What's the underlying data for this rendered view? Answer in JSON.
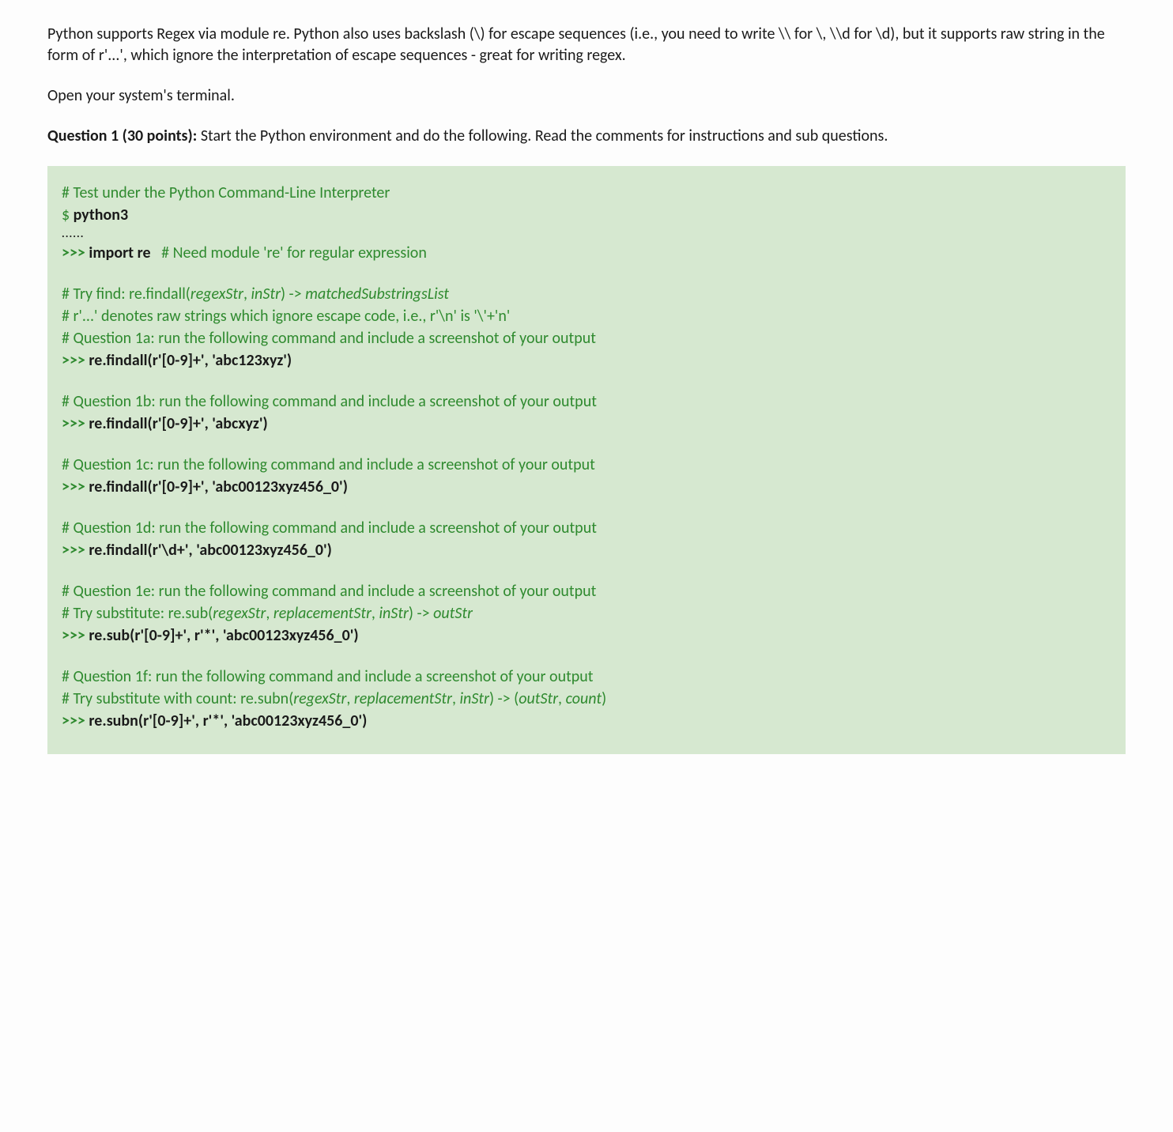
{
  "intro": {
    "p1": "Python supports Regex via module re. Python also uses backslash (\\) for escape sequences (i.e., you need to write \\\\ for \\, \\\\d for \\d), but it supports raw string in the form of r'...', which ignore the interpretation of escape sequences - great for writing regex.",
    "p2": "Open your system's terminal.",
    "q_lead_bold": "Question 1 (30 points): ",
    "q_lead_rest": "Start the Python environment and do the following. Read the comments for instructions and sub questions."
  },
  "code": {
    "c1": "# Test under the Python Command-Line Interpreter",
    "dollar": "$ ",
    "py3": "python3",
    "dots": "......",
    "prompt": ">>> ",
    "import_kw": "import re",
    "import_comment": "   # Need module 're' for regular expression",
    "find_h1a": "# Try find: re.findall(",
    "find_h1b": "regexStr",
    "find_h1c": ", ",
    "find_h1d": "inStr",
    "find_h1e": ") -> ",
    "find_h1f": "matchedSubstringsList",
    "find_h2": "# r'...' denotes raw strings which ignore escape code, i.e., r'\\n' is '\\'+'n'",
    "q1a_c": "# Question 1a: run the following command and include a screenshot of your output",
    "q1a_cmd": "re.findall(r'[0-9]+', 'abc123xyz')",
    "q1b_c": "# Question 1b: run the following command and include a screenshot of your output",
    "q1b_cmd": "re.findall(r'[0-9]+', 'abcxyz')",
    "q1c_c": "# Question 1c: run the following command and include a screenshot of your output",
    "q1c_cmd": "re.findall(r'[0-9]+', 'abc00123xyz456_0')",
    "q1d_c": "# Question 1d: run the following command and include a screenshot of your output",
    "q1d_cmd": "re.findall(r'\\d+', 'abc00123xyz456_0')",
    "q1e_c": "# Question 1e: run the following command and include a screenshot of your output",
    "q1e_h1a": "# Try substitute: re.sub(",
    "q1e_h1b": "regexStr",
    "q1e_h1c": ", ",
    "q1e_h1d": "replacementStr",
    "q1e_h1e": ", ",
    "q1e_h1f": "inStr",
    "q1e_h1g": ") -> ",
    "q1e_h1h": "outStr",
    "q1e_cmd": "re.sub(r'[0-9]+', r'*', 'abc00123xyz456_0')",
    "q1f_c": "# Question 1f: run the following command and include a screenshot of your output",
    "q1f_h1a": "# Try substitute with count: re.subn(",
    "q1f_h1b": "regexStr",
    "q1f_h1c": ", ",
    "q1f_h1d": "replacementStr",
    "q1f_h1e": ", ",
    "q1f_h1f": "inStr",
    "q1f_h1g": ") -> (",
    "q1f_h1h": "outStr",
    "q1f_h1i": ", ",
    "q1f_h1j": "count",
    "q1f_h1k": ")",
    "q1f_cmd": "re.subn(r'[0-9]+', r'*', 'abc00123xyz456_0')"
  }
}
